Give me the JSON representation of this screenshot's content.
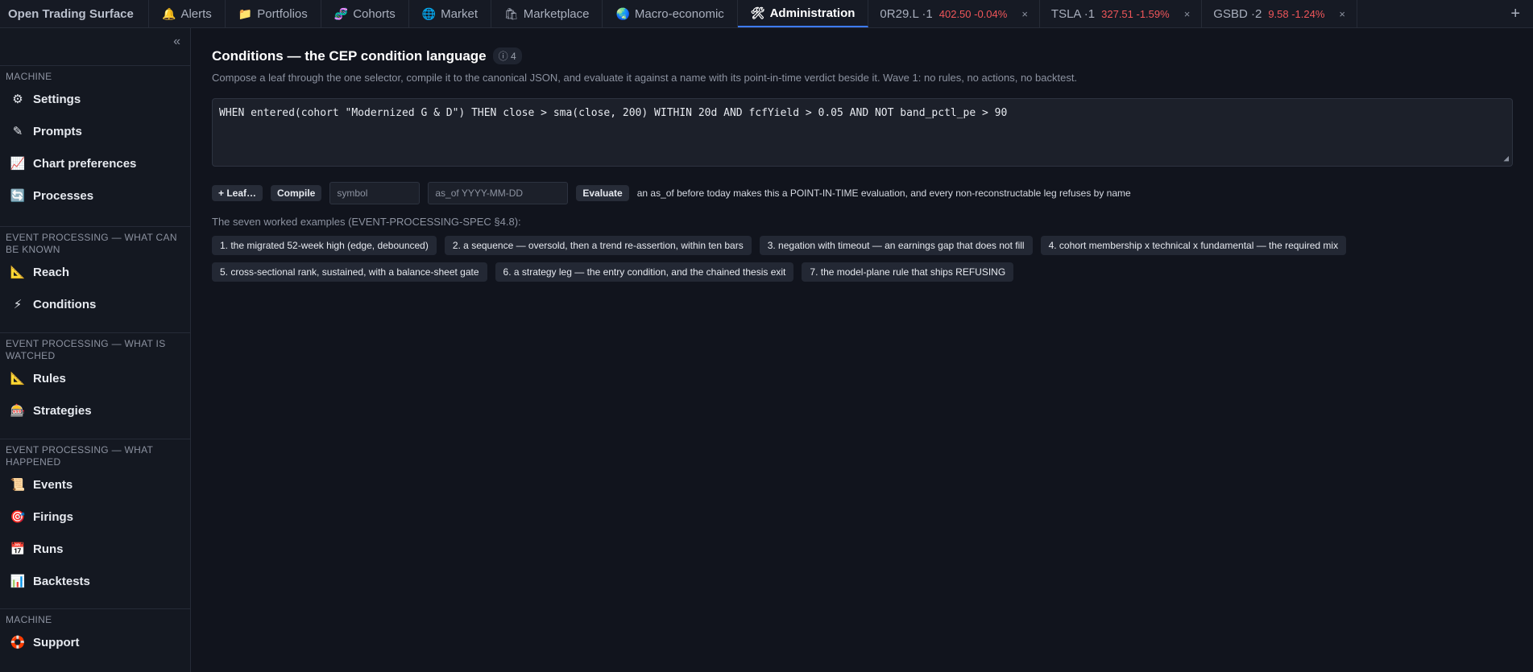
{
  "app": {
    "title": "Open Trading Surface"
  },
  "tabs": [
    {
      "icon": "🔔",
      "label": "Alerts",
      "icon_name": "bell-icon"
    },
    {
      "icon": "📁",
      "label": "Portfolios",
      "icon_name": "folder-icon"
    },
    {
      "icon": "🧬",
      "label": "Cohorts",
      "icon_name": "dna-icon"
    },
    {
      "icon": "🌐",
      "label": "Market",
      "icon_name": "globe-icon"
    },
    {
      "icon": "🛍",
      "label": "Marketplace",
      "icon_name": "shopping-bag-icon"
    },
    {
      "icon": "🌏",
      "label": "Macro-economic",
      "icon_name": "earth-icon"
    },
    {
      "icon": "🛠",
      "label": "Administration",
      "icon_name": "tools-icon",
      "active": true
    }
  ],
  "tickers": [
    {
      "symbol": "0R29.L ·1",
      "quote": "402.50 -0.04%",
      "close": "×"
    },
    {
      "symbol": "TSLA ·1",
      "quote": "327.51 -1.59%",
      "close": "×"
    },
    {
      "symbol": "GSBD ·2",
      "quote": "9.58 -1.24%",
      "close": "×"
    }
  ],
  "add_tab": "+",
  "sidebar": {
    "collapse": "«",
    "sections": [
      {
        "title": "MACHINE",
        "items": [
          {
            "icon": "⚙",
            "label": "Settings",
            "icon_name": "gear-icon"
          },
          {
            "icon": "✎",
            "label": "Prompts",
            "icon_name": "pencil-icon"
          },
          {
            "icon": "📈",
            "label": "Chart preferences",
            "icon_name": "chart-up-icon"
          },
          {
            "icon": "🔄",
            "label": "Processes",
            "icon_name": "refresh-icon"
          }
        ]
      },
      {
        "title": "EVENT PROCESSING — WHAT CAN BE KNOWN",
        "items": [
          {
            "icon": "📐",
            "label": "Reach",
            "icon_name": "triangle-ruler-icon"
          },
          {
            "icon": "⚡",
            "label": "Conditions",
            "icon_name": "lightning-icon"
          }
        ]
      },
      {
        "title": "EVENT PROCESSING — WHAT IS WATCHED",
        "items": [
          {
            "icon": "📐",
            "label": "Rules",
            "icon_name": "triangle-ruler-icon"
          },
          {
            "icon": "🎰",
            "label": "Strategies",
            "icon_name": "slot-machine-icon"
          }
        ]
      },
      {
        "title": "EVENT PROCESSING — WHAT HAPPENED",
        "items": [
          {
            "icon": "📜",
            "label": "Events",
            "icon_name": "scroll-icon"
          },
          {
            "icon": "🎯",
            "label": "Firings",
            "icon_name": "target-icon"
          },
          {
            "icon": "📅",
            "label": "Runs",
            "icon_name": "calendar-icon"
          },
          {
            "icon": "📊",
            "label": "Backtests",
            "icon_name": "bar-chart-icon"
          }
        ]
      },
      {
        "title": "MACHINE",
        "items": [
          {
            "icon": "🛟",
            "label": "Support",
            "icon_name": "lifebuoy-icon"
          }
        ]
      }
    ]
  },
  "main": {
    "title": "Conditions — the CEP condition language",
    "badge": "ⓘ 4",
    "subtitle": "Compose a leaf through the one selector, compile it to the canonical JSON, and evaluate it against a name with its point-in-time verdict beside it. Wave 1: no rules, no actions, no backtest.",
    "editor_value": "WHEN entered(cohort \"Modernized G & D\") THEN close > sma(close, 200) WITHIN 20d AND fcfYield > 0.05 AND NOT band_pctl_pe > 90",
    "leaf_button": "+ Leaf…",
    "compile_button": "Compile",
    "symbol_placeholder": "symbol",
    "asof_placeholder": "as_of YYYY-MM-DD",
    "evaluate_button": "Evaluate",
    "hint": "an as_of before today makes this a POINT-IN-TIME evaluation, and every non-reconstructable leg refuses by name",
    "examples_label": "The seven worked examples (EVENT-PROCESSING-SPEC §4.8):",
    "examples": [
      "1. the migrated 52-week high (edge, debounced)",
      "2. a sequence — oversold, then a trend re-assertion, within ten bars",
      "3. negation with timeout — an earnings gap that does not fill",
      "4. cohort membership x technical x fundamental — the required mix",
      "5. cross-sectional rank, sustained, with a balance-sheet gate",
      "6. a strategy leg — the entry condition, and the chained thesis exit",
      "7. the model-plane rule that ships REFUSING"
    ]
  }
}
